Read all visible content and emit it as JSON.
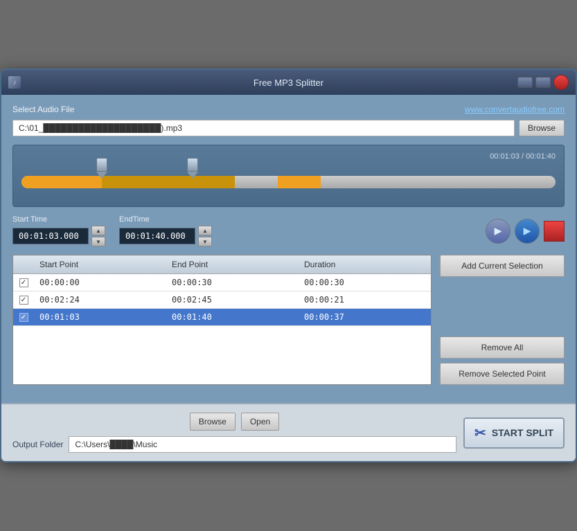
{
  "window": {
    "title": "Free MP3 Splitter"
  },
  "header": {
    "select_label": "Select Audio File",
    "website_link": "www.convertaudiofree.com",
    "file_path": "C:\\01_████████████████████).mp3",
    "browse_label": "Browse"
  },
  "waveform": {
    "time_display": "00:01:03 / 00:01:40"
  },
  "time_controls": {
    "start_label": "Start Time",
    "start_value": "00:01:03.000",
    "end_label": "EndTime",
    "end_value": "00:01:40.000"
  },
  "table": {
    "headers": [
      "",
      "Start Point",
      "End Point",
      "Duration"
    ],
    "rows": [
      {
        "checked": true,
        "start": "00:00:00",
        "end": "00:00:30",
        "duration": "00:00:30",
        "selected": false
      },
      {
        "checked": true,
        "start": "00:02:24",
        "end": "00:02:45",
        "duration": "00:00:21",
        "selected": false
      },
      {
        "checked": true,
        "start": "00:01:03",
        "end": "00:01:40",
        "duration": "00:00:37",
        "selected": true
      }
    ]
  },
  "side_buttons": {
    "add_label": "Add Current Selection",
    "remove_all_label": "Remove All",
    "remove_point_label": "Remove Selected Point"
  },
  "bottom": {
    "output_label": "Output Folder",
    "output_path": "C:\\Users\\████\\Music",
    "browse_label": "Browse",
    "open_label": "Open",
    "start_split_label": "START SPLIT"
  }
}
